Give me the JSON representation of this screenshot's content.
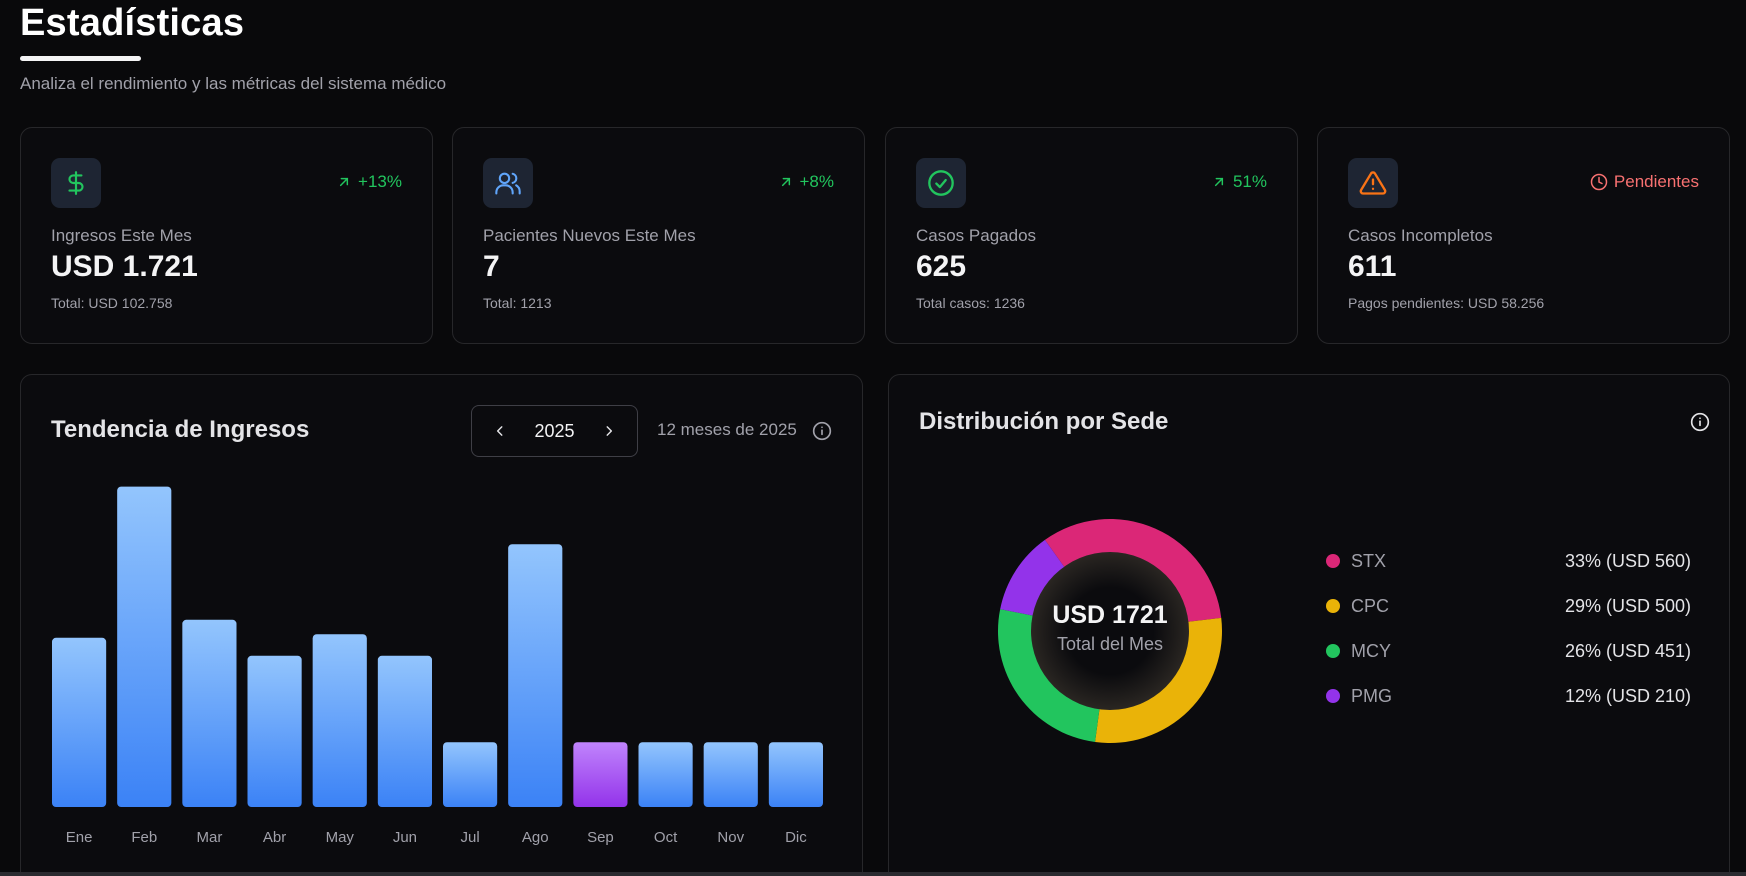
{
  "header": {
    "title": "Estadísticas",
    "subtitle": "Analiza el rendimiento y las métricas del sistema médico"
  },
  "stats": [
    {
      "icon": "dollar-icon",
      "trend": "+13%",
      "trend_type": "up",
      "label": "Ingresos Este Mes",
      "value": "USD 1.721",
      "sub": "Total: USD 102.758"
    },
    {
      "icon": "users-icon",
      "trend": "+8%",
      "trend_type": "up",
      "label": "Pacientes Nuevos Este Mes",
      "value": "7",
      "sub": "Total: 1213"
    },
    {
      "icon": "check-circle-icon",
      "trend": "51%",
      "trend_type": "up",
      "label": "Casos Pagados",
      "value": "625",
      "sub": "Total casos: 1236"
    },
    {
      "icon": "warning-icon",
      "trend": "Pendientes",
      "trend_type": "warn",
      "label": "Casos Incompletos",
      "value": "611",
      "sub": "Pagos pendientes: USD 58.256"
    }
  ],
  "revenue": {
    "title": "Tendencia de Ingresos",
    "year": "2025",
    "range_label": "12 meses de 2025"
  },
  "distribution": {
    "title": "Distribución por Sede",
    "center_value": "USD 1721",
    "center_caption": "Total del Mes",
    "items": [
      {
        "name": "STX",
        "value": "33% (USD 560)",
        "color": "#db2777"
      },
      {
        "name": "CPC",
        "value": "29% (USD 500)",
        "color": "#eab308"
      },
      {
        "name": "MCY",
        "value": "26% (USD 451)",
        "color": "#22c55e"
      },
      {
        "name": "PMG",
        "value": "12% (USD 210)",
        "color": "#9333ea"
      }
    ]
  },
  "colors": {
    "bar_top": "#93c5fd",
    "bar_bottom": "#3b82f6",
    "bar_highlight_top": "#c084fc",
    "bar_highlight_bottom": "#9333ea",
    "trend_up": "#22c55e",
    "trend_warn": "#f87171"
  },
  "chart_data": [
    {
      "type": "bar",
      "title": "Tendencia de Ingresos",
      "categories": [
        "Ene",
        "Feb",
        "Mar",
        "Abr",
        "May",
        "Jun",
        "Jul",
        "Ago",
        "Sep",
        "Oct",
        "Nov",
        "Dic"
      ],
      "values": [
        4.7,
        8.9,
        5.2,
        4.2,
        4.8,
        4.2,
        1.8,
        7.3,
        1.8,
        1.8,
        1.8,
        1.8
      ],
      "highlight": "Sep",
      "ylim": [
        0,
        9
      ],
      "grid": false
    },
    {
      "type": "pie",
      "title": "Distribución por Sede",
      "categories": [
        "STX",
        "CPC",
        "MCY",
        "PMG"
      ],
      "values": [
        33,
        29,
        26,
        12
      ],
      "amounts": [
        560,
        500,
        451,
        210
      ]
    }
  ]
}
